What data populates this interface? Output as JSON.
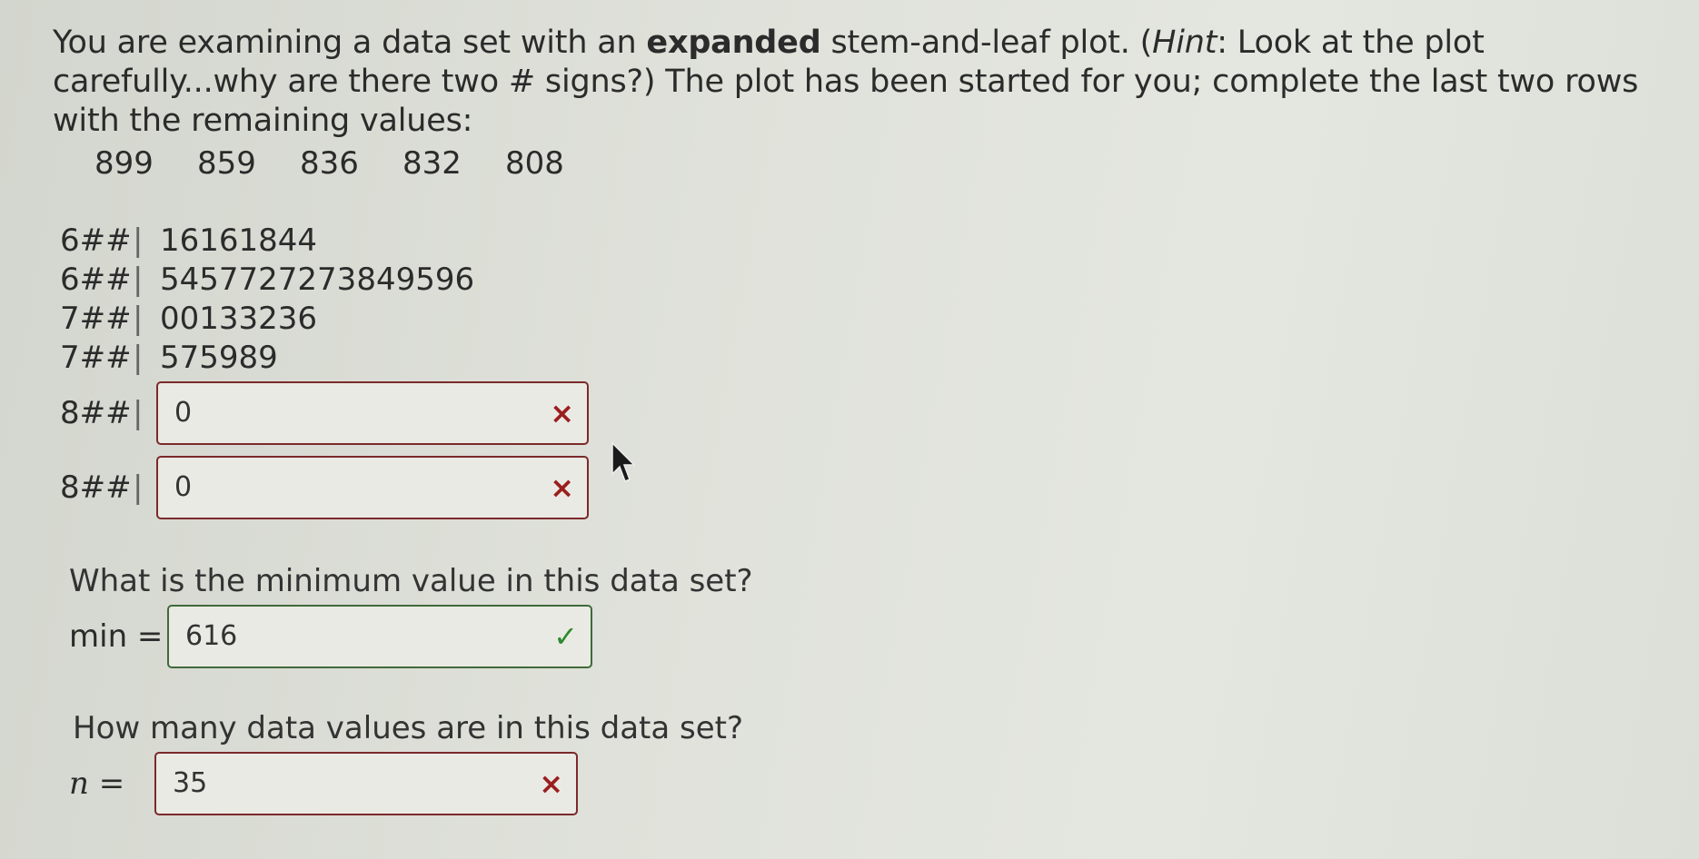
{
  "question": {
    "part1": "You are examining a data set with an ",
    "bold": "expanded",
    "part2": " stem-and-leaf plot. (",
    "italic": "Hint",
    "part3": ": Look at the plot carefully...why are there two # signs?) The plot has been started for you; complete the last two rows with the remaining values:"
  },
  "values": [
    "899",
    "859",
    "836",
    "832",
    "808"
  ],
  "plot": {
    "separator": "|",
    "rows": [
      {
        "stem": "6##",
        "leaves": "16161844"
      },
      {
        "stem": "6##",
        "leaves": "5457727273849596"
      },
      {
        "stem": "7##",
        "leaves": "00133236"
      },
      {
        "stem": "7##",
        "leaves": "575989"
      }
    ],
    "inputs": [
      {
        "stem": "8##",
        "value": "0",
        "status": "incorrect"
      },
      {
        "stem": "8##",
        "value": "0",
        "status": "incorrect"
      }
    ]
  },
  "min_question": {
    "prompt": "What is the minimum value in this data set?",
    "label": "min =",
    "value": "616",
    "status": "correct"
  },
  "n_question": {
    "prompt": "How many data values are in this data set?",
    "label": "n =",
    "value": "35",
    "status": "incorrect"
  },
  "icons": {
    "incorrect": "×",
    "correct": "✓"
  }
}
